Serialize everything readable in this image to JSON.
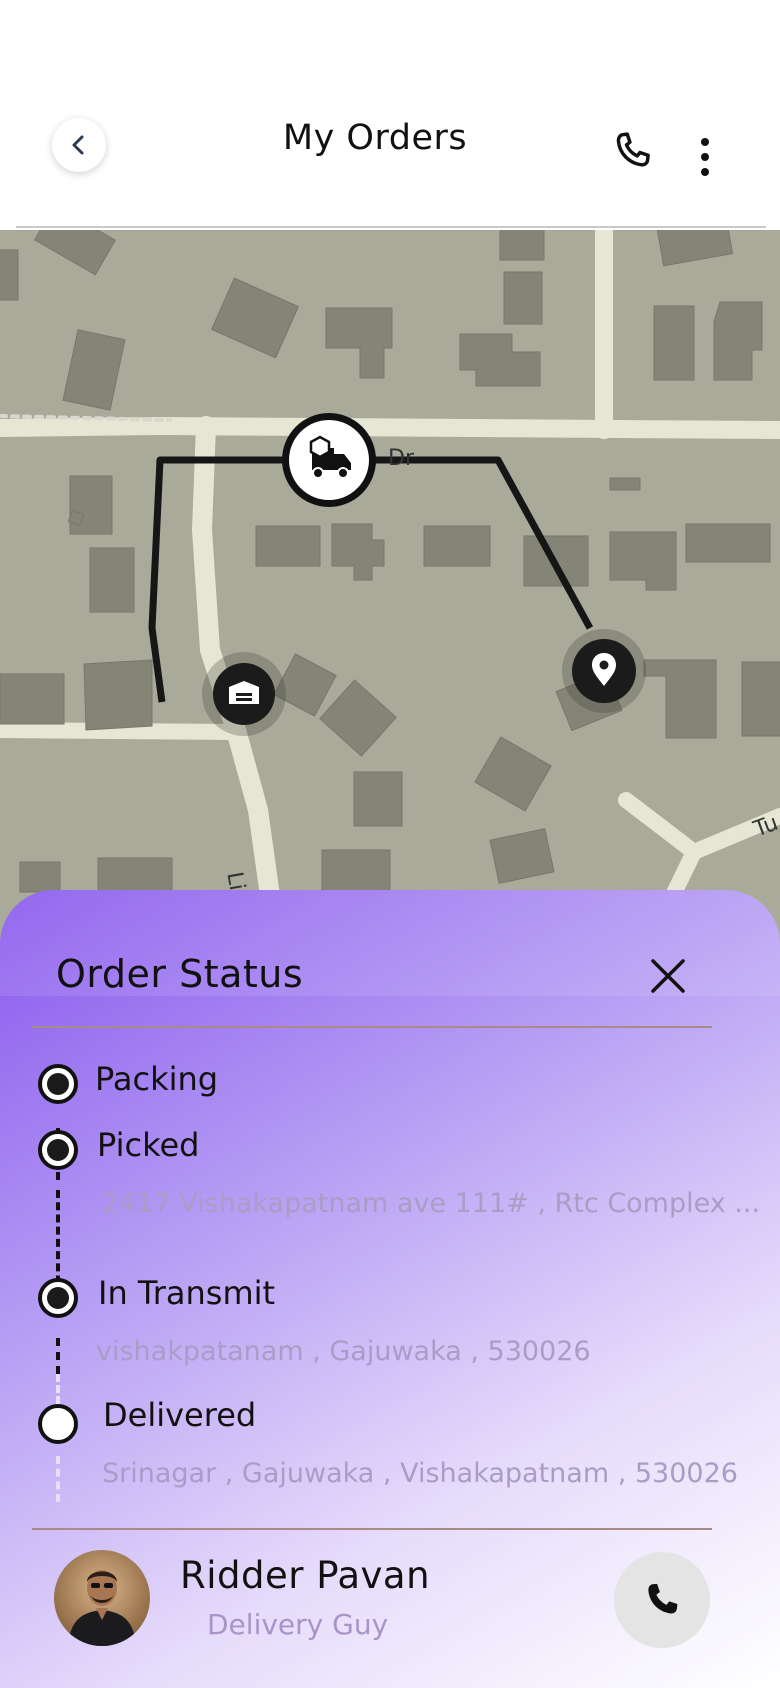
{
  "header": {
    "title": "My Orders",
    "back_icon": "chevron-left-icon",
    "phone_icon": "phone-icon",
    "more_icon": "more-vertical-icon"
  },
  "map": {
    "street_labels": [
      "Dr",
      "Little Tre",
      "Tu"
    ],
    "markers": [
      "warehouse-icon",
      "delivery-truck-icon",
      "location-pin-icon"
    ]
  },
  "order_status": {
    "title": "Order Status",
    "close_icon": "close-icon",
    "steps": [
      {
        "label": "Packing",
        "sub": "",
        "done": true
      },
      {
        "label": "Picked",
        "sub": "2417 Vishakapatnam ave 111# , Rtc Complex ...",
        "done": true
      },
      {
        "label": "In Transmit",
        "sub": "vishakpatanam , Gajuwaka , 530026",
        "done": true
      },
      {
        "label": "Delivered",
        "sub": "Srinagar , Gajuwaka , Vishakapatnam , 530026",
        "done": false
      }
    ]
  },
  "driver": {
    "name": "Ridder Pavan",
    "role": "Delivery Guy",
    "call_icon": "phone-icon"
  },
  "colors": {
    "accent": "#8858ee",
    "map_ground": "#a9aa9a",
    "map_building": "#848477",
    "map_road": "#e6e6d4",
    "route": "#161616"
  }
}
